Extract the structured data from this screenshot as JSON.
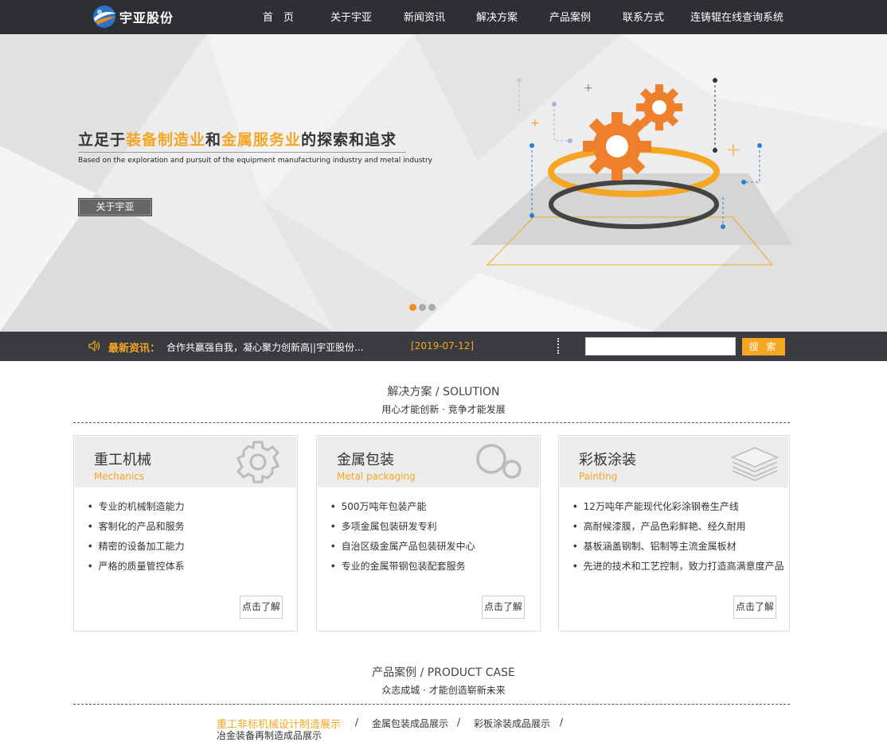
{
  "nav": {
    "brand": "宇亚股份",
    "items": [
      "首　页",
      "关于宇亚",
      "新闻资讯",
      "解决方案",
      "产品案例",
      "联系方式",
      "连铸辊在线查询系统"
    ]
  },
  "banner": {
    "headline_1": "立足于",
    "headline_2": "装备制造业",
    "headline_3": "和",
    "headline_4": "金属服务业",
    "headline_5": "的探索和追求",
    "subline": "Based on the exploration and pursuit of the equipment manufacturing industry and metal industry",
    "button": "关于宇亚",
    "slides": 3,
    "active_slide": 1
  },
  "news": {
    "label": "最新资讯：",
    "headline": "合作共赢强自我，凝心聚力创新高||宇亚股份...",
    "date": "[2019-07-12]",
    "search_value": "",
    "search_button": "搜 索"
  },
  "solution": {
    "title": "解决方案 / SOLUTION",
    "subtitle": "用心才能创新 · 竞争才能发展",
    "cards": [
      {
        "title": "重工机械",
        "en": "Mechanics",
        "icon": "gear-icon",
        "items": [
          "专业的机械制造能力",
          "客制化的产品和服务",
          "精密的设备加工能力",
          "严格的质量管控体系"
        ],
        "more": "点击了解"
      },
      {
        "title": "金属包装",
        "en": "Metal packaging",
        "icon": "rings-icon",
        "items": [
          "500万吨年包装产能",
          "多项金属包装研发专利",
          "自治区级金属产品包装研发中心",
          "专业的金属带钢包装配套服务"
        ],
        "more": "点击了解"
      },
      {
        "title": "彩板涂装",
        "en": "Painting",
        "icon": "layers-icon",
        "items": [
          "12万吨年产能现代化彩涂钢卷生产线",
          "高耐候漆膜，产品色彩鲜艳、经久耐用",
          "基板涵盖钢制、铝制等主流金属板材",
          "先进的技术和工艺控制，致力打造高满意度产品"
        ],
        "more": "点击了解"
      }
    ]
  },
  "product": {
    "title": "产品案例 / PRODUCT CASE",
    "subtitle": "众志成城 · 才能创造崭新未来",
    "categories": [
      "重工非标机械设计制造展示",
      "金属包装成品展示",
      "彩板涂装成品展示",
      "冶金装备再制造成品展示"
    ],
    "separator": "/"
  },
  "colors": {
    "accent": "#f5a623",
    "nav_bg": "#2e2f33",
    "news_bg": "#3a3b3f",
    "gear": "#ef7f2b"
  }
}
